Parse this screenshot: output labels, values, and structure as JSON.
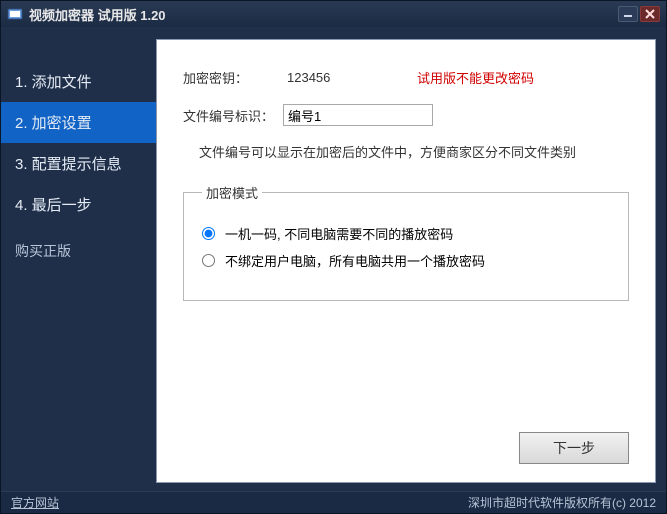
{
  "titlebar": {
    "title": "视频加密器 试用版 1.20"
  },
  "sidebar": {
    "items": [
      {
        "label": "1. 添加文件",
        "active": false
      },
      {
        "label": "2. 加密设置",
        "active": true
      },
      {
        "label": "3. 配置提示信息",
        "active": false
      },
      {
        "label": "4. 最后一步",
        "active": false
      }
    ],
    "buy_label": "购买正版"
  },
  "main": {
    "key_label": "加密密钥：",
    "key_value": "123456",
    "trial_note": "试用版不能更改密码",
    "fileid_label": "文件编号标识：",
    "fileid_value": "编号1",
    "fileid_hint": "文件编号可以显示在加密后的文件中，方便商家区分不同文件类别",
    "mode_legend": "加密模式",
    "mode_options": [
      "一机一码, 不同电脑需要不同的播放密码",
      "不绑定用户电脑，所有电脑共用一个播放密码"
    ],
    "next_label": "下一步"
  },
  "statusbar": {
    "left": "官方网站",
    "right": "深圳市超时代软件版权所有(c) 2012"
  }
}
